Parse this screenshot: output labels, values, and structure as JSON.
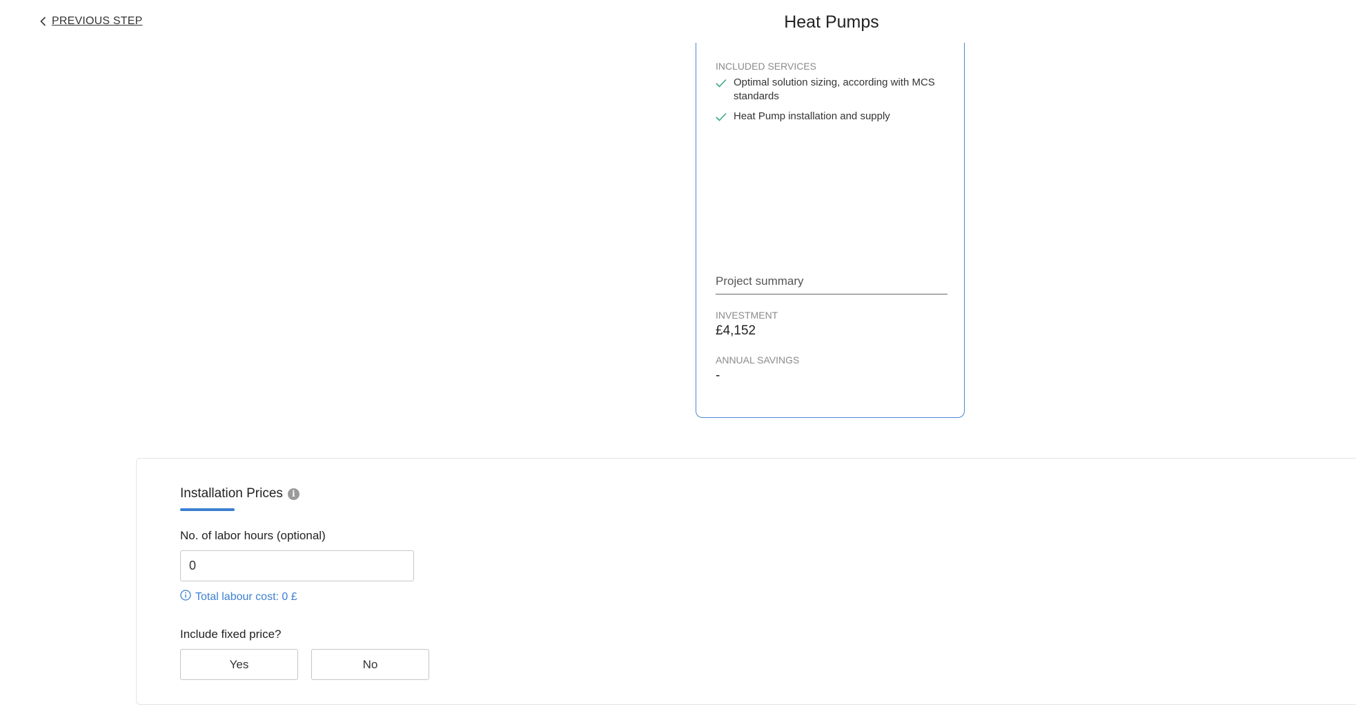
{
  "header": {
    "back_label": "PREVIOUS STEP",
    "title": "Heat Pumps"
  },
  "offer_card": {
    "included_services_label": "INCLUDED SERVICES",
    "services": [
      "Optimal solution sizing, according with MCS standards",
      "Heat Pump installation and supply"
    ],
    "project_summary_title": "Project summary",
    "investment_label": "INVESTMENT",
    "investment_value": "£4,152",
    "annual_savings_label": "ANNUAL SAVINGS",
    "annual_savings_value": "-",
    "accent_color": "#4a86d0",
    "check_color": "#3aa77a"
  },
  "installation": {
    "title": "Installation Prices",
    "info_icon": "info-icon",
    "labor_hours_label": "No. of labor hours (optional)",
    "labor_hours_value": "0",
    "labour_cost_note": "Total labour cost: 0 £",
    "fixed_price_label": "Include fixed price?",
    "yes_label": "Yes",
    "no_label": "No",
    "accent_color": "#3b7fd0"
  }
}
